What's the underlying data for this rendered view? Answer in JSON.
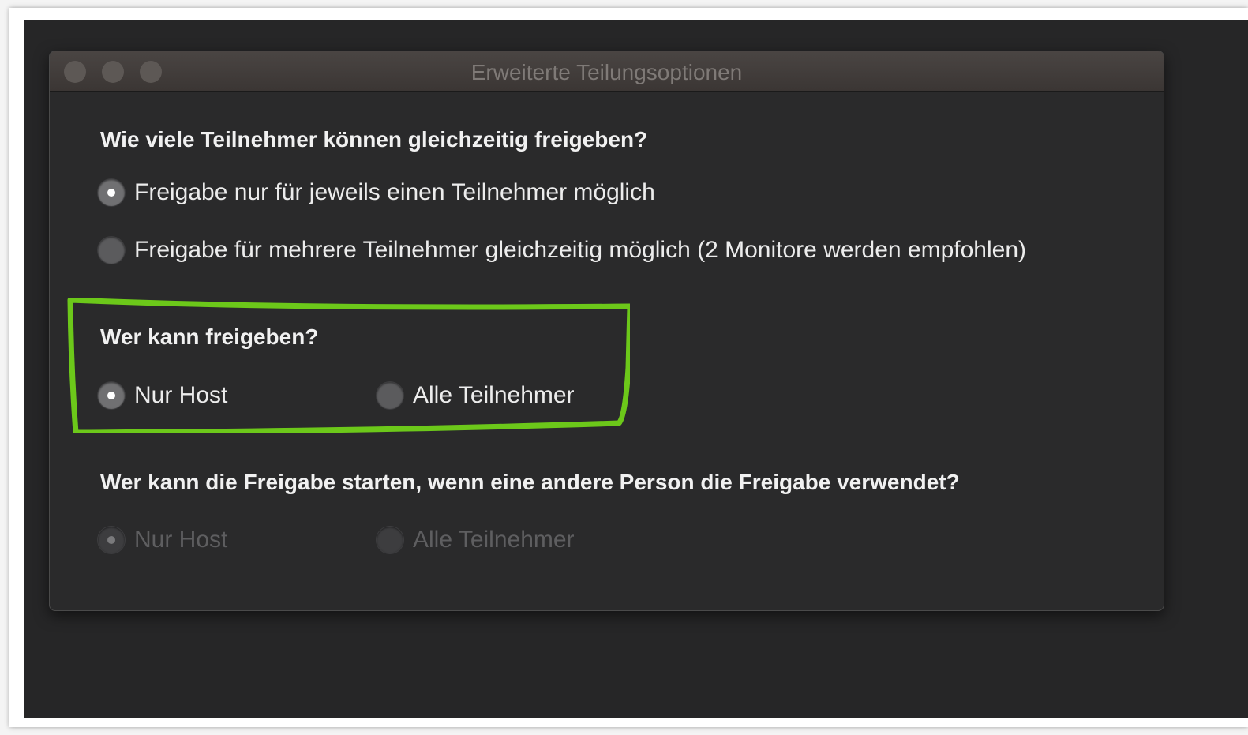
{
  "window": {
    "title": "Erweiterte Teilungsoptionen"
  },
  "section1": {
    "heading": "Wie viele Teilnehmer können gleichzeitig freigeben?",
    "options": [
      {
        "label": "Freigabe nur für jeweils einen Teilnehmer möglich",
        "selected": true
      },
      {
        "label": "Freigabe für mehrere Teilnehmer gleichzeitig möglich (2 Monitore werden empfohlen)",
        "selected": false
      }
    ]
  },
  "section2": {
    "heading": "Wer kann freigeben?",
    "options": [
      {
        "label": "Nur Host",
        "selected": true
      },
      {
        "label": "Alle Teilnehmer",
        "selected": false
      }
    ]
  },
  "section3": {
    "heading": "Wer kann die Freigabe starten, wenn eine andere Person die Freigabe verwendet?",
    "disabled": true,
    "options": [
      {
        "label": "Nur Host",
        "selected": true
      },
      {
        "label": "Alle Teilnehmer",
        "selected": false
      }
    ]
  },
  "annotation": {
    "color": "#6cc81a"
  }
}
